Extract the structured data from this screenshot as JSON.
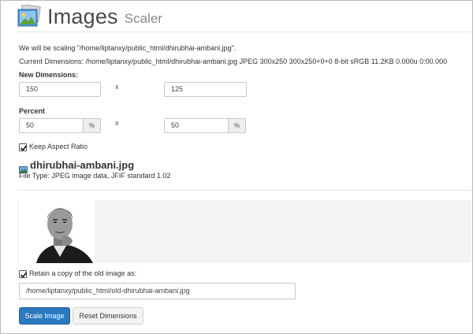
{
  "header": {
    "title": "Images",
    "subtitle": "Scaler"
  },
  "info": {
    "scaling_text": "We will be scaling \"/home/liptanxy/public_html/dhirubhai-ambani.jpg\".",
    "current_dimensions": "Current Dimensions: /home/liptanxy/public_html/dhirubhai-ambani.jpg JPEG 300x250 300x250+0+0 8-bit sRGB 11.2KB 0.000u 0:00.000"
  },
  "new_dimensions": {
    "label": "New Dimensions:",
    "width": "150",
    "height": "125",
    "separator": "x"
  },
  "percent": {
    "label": "Percent",
    "width": "50",
    "height": "50",
    "unit": "%",
    "separator": "x"
  },
  "keep_aspect_ratio": {
    "label": "Keep Aspect Ratio",
    "checked": true
  },
  "file": {
    "name": "dhirubhai-ambani.jpg",
    "type": "File Type: JPEG image data, JFIF standard 1.02"
  },
  "retain_copy": {
    "label": "Retain a copy of the old image as:",
    "checked": true,
    "path": "/home/liptanxy/public_html/old-dhirubhai-ambani.jpg"
  },
  "buttons": {
    "scale": "Scale Image",
    "reset": "Reset Dimensions"
  },
  "colors": {
    "primary": "#2c79bf",
    "border": "#c8c8c8",
    "addon_bg": "#eeeeee"
  },
  "icons": [
    "images-app-icon",
    "checkmark-icon",
    "image-file-icon"
  ]
}
